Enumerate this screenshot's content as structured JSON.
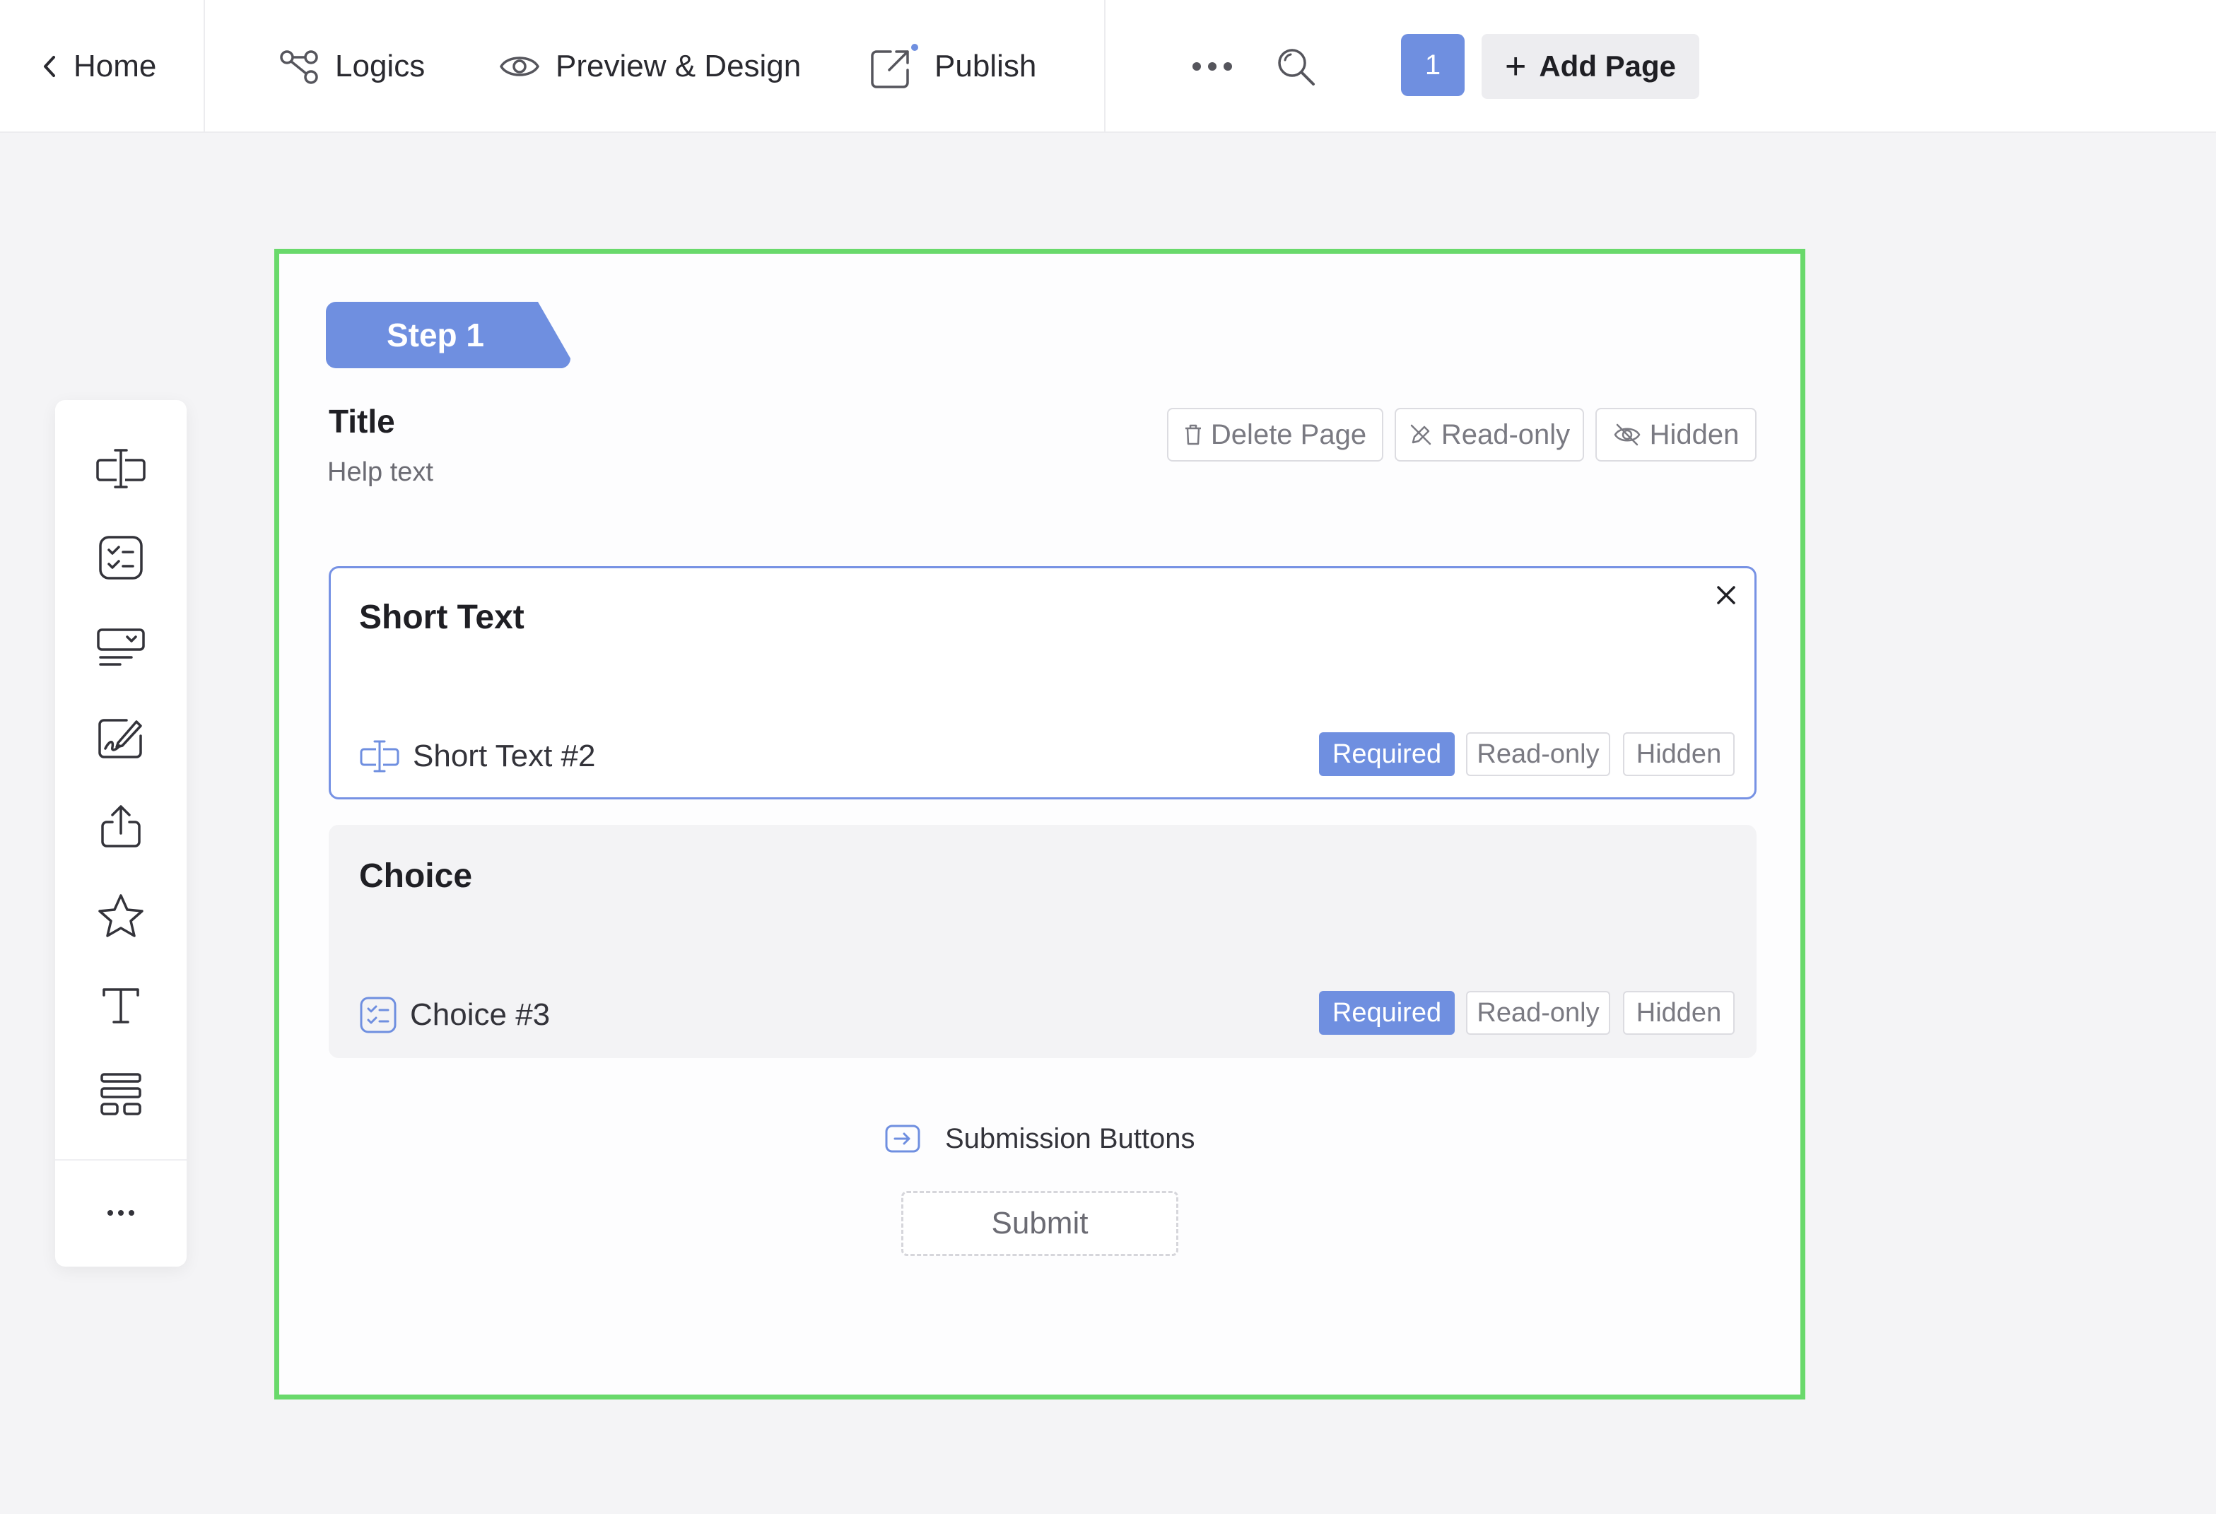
{
  "topbar": {
    "home": "Home",
    "logics": "Logics",
    "preview": "Preview & Design",
    "publish": "Publish",
    "page_number": "1",
    "add_page": "Add Page"
  },
  "palette": {
    "tools": [
      "short-text",
      "choice",
      "dropdown",
      "signature",
      "upload",
      "rating",
      "text",
      "layout",
      "more"
    ]
  },
  "page": {
    "step_label": "Step 1",
    "title": "Title",
    "help_text": "Help text",
    "actions": {
      "delete": "Delete Page",
      "readonly": "Read-only",
      "hidden": "Hidden"
    }
  },
  "fields": [
    {
      "title": "Short Text",
      "id_label": "Short Text #2",
      "required": "Required",
      "readonly": "Read-only",
      "hidden": "Hidden",
      "selected": true
    },
    {
      "title": "Choice",
      "id_label": "Choice #3",
      "required": "Required",
      "readonly": "Read-only",
      "hidden": "Hidden",
      "selected": false
    }
  ],
  "submission": {
    "label": "Submission Buttons",
    "submit": "Submit"
  },
  "colors": {
    "accent": "#6f8fe0",
    "canvas_border": "#69d96b",
    "background": "#f4f4f6"
  }
}
